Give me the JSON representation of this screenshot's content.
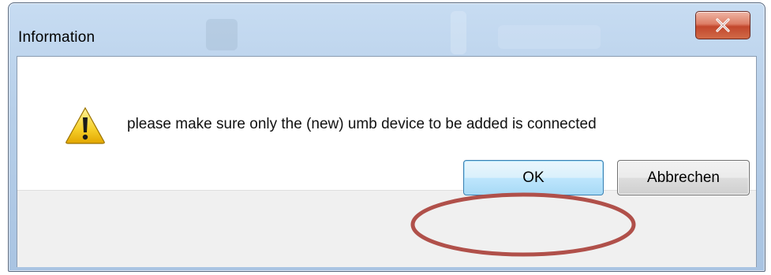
{
  "window": {
    "title": "Information"
  },
  "dialog": {
    "message": "please make sure only the (new) umb device to be added is connected",
    "icon": "warning-icon"
  },
  "buttons": {
    "ok_label": "OK",
    "cancel_label": "Abbrechen"
  },
  "colors": {
    "annotation_ellipse": "#b0504a",
    "ok_border": "#3c7fb1",
    "close_button": "#c2472d"
  }
}
